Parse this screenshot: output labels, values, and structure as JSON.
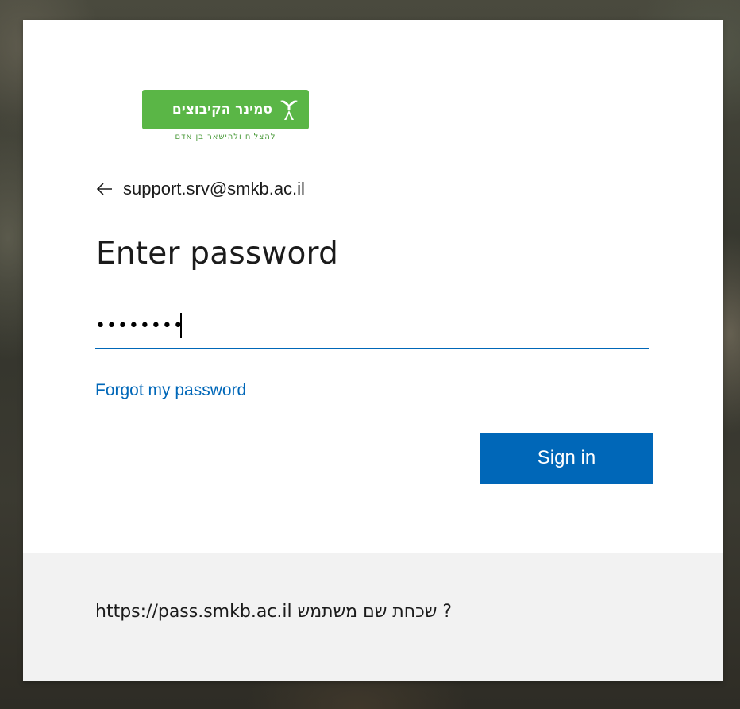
{
  "logo": {
    "name": "סמינר הקיבוצים",
    "tagline": "להצליח ולהישאר בן אדם",
    "accent_color": "#5ab646",
    "icon": "seminar-emblem-icon"
  },
  "identity": {
    "back_icon": "back-arrow-icon",
    "email": "support.srv@smkb.ac.il"
  },
  "form": {
    "title": "Enter password",
    "password_value": "••••••••",
    "forgot_label": "Forgot my password",
    "signin_label": "Sign in"
  },
  "footer": {
    "text": "? שכחת שם משתמש https://pass.smkb.ac.il"
  },
  "colors": {
    "primary": "#0067b8",
    "footer_bg": "#f2f2f2",
    "text": "#1b1b1b"
  }
}
